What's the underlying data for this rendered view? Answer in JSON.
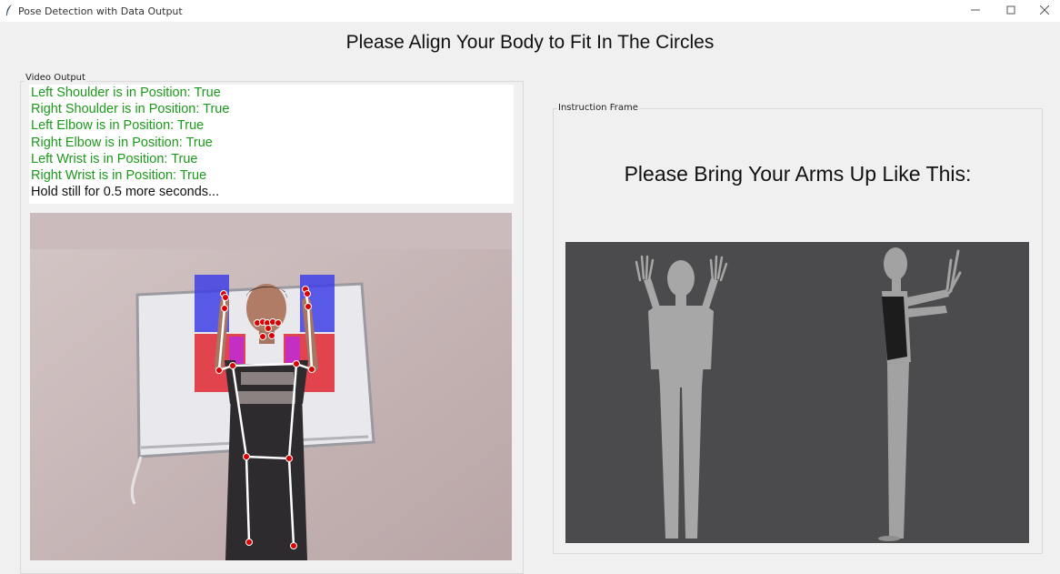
{
  "window": {
    "title": "Pose Detection with Data Output"
  },
  "heading": "Please Align Your Body to Fit In The Circles",
  "video_output": {
    "label": "Video Output",
    "status_lines": [
      "Left Shoulder is in Position: True",
      "Right Shoulder is in Position: True",
      "Left Elbow is in Position: True",
      "Right Elbow is in Position: True",
      "Left Wrist is in Position: True",
      "Right Wrist is in Position: True"
    ],
    "hold_message": "Hold still for 0.5 more seconds..."
  },
  "instruction_frame": {
    "label": "Instruction Frame",
    "instruction": "Please Bring Your Arms Up Like This:"
  },
  "colors": {
    "status_ok": "#1b9a1b",
    "target_zone_upper": "#3f3fe6",
    "target_zone_lower": "#e0202a",
    "landmark": "#d80000"
  }
}
